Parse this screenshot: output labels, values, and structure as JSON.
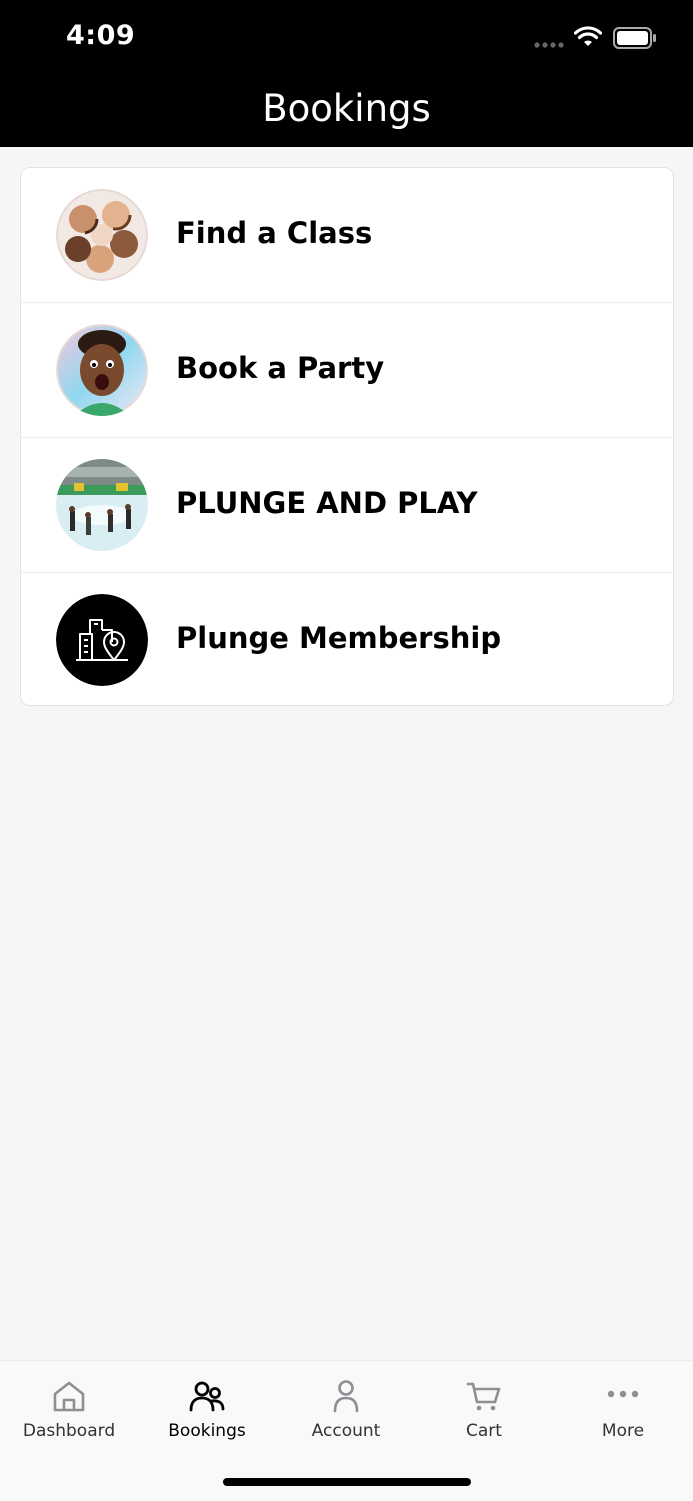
{
  "status_bar": {
    "time": "4:09"
  },
  "header": {
    "title": "Bookings"
  },
  "menu": {
    "items": [
      {
        "label": "Find a Class",
        "icon": "kids-group-photo"
      },
      {
        "label": "Book a Party",
        "icon": "excited-child-photo"
      },
      {
        "label": "PLUNGE AND PLAY",
        "icon": "pool-play-photo"
      },
      {
        "label": "Plunge Membership",
        "icon": "building-location-icon"
      }
    ]
  },
  "tabs": [
    {
      "label": "Dashboard",
      "icon": "home-icon",
      "active": false
    },
    {
      "label": "Bookings",
      "icon": "people-icon",
      "active": true
    },
    {
      "label": "Account",
      "icon": "person-icon",
      "active": false
    },
    {
      "label": "Cart",
      "icon": "cart-icon",
      "active": false
    },
    {
      "label": "More",
      "icon": "more-dots-icon",
      "active": false
    }
  ],
  "colors": {
    "active_tab": "#000000",
    "inactive_tab": "#8e8e93",
    "header_bg": "#000000",
    "page_bg": "#f6f6f8"
  }
}
